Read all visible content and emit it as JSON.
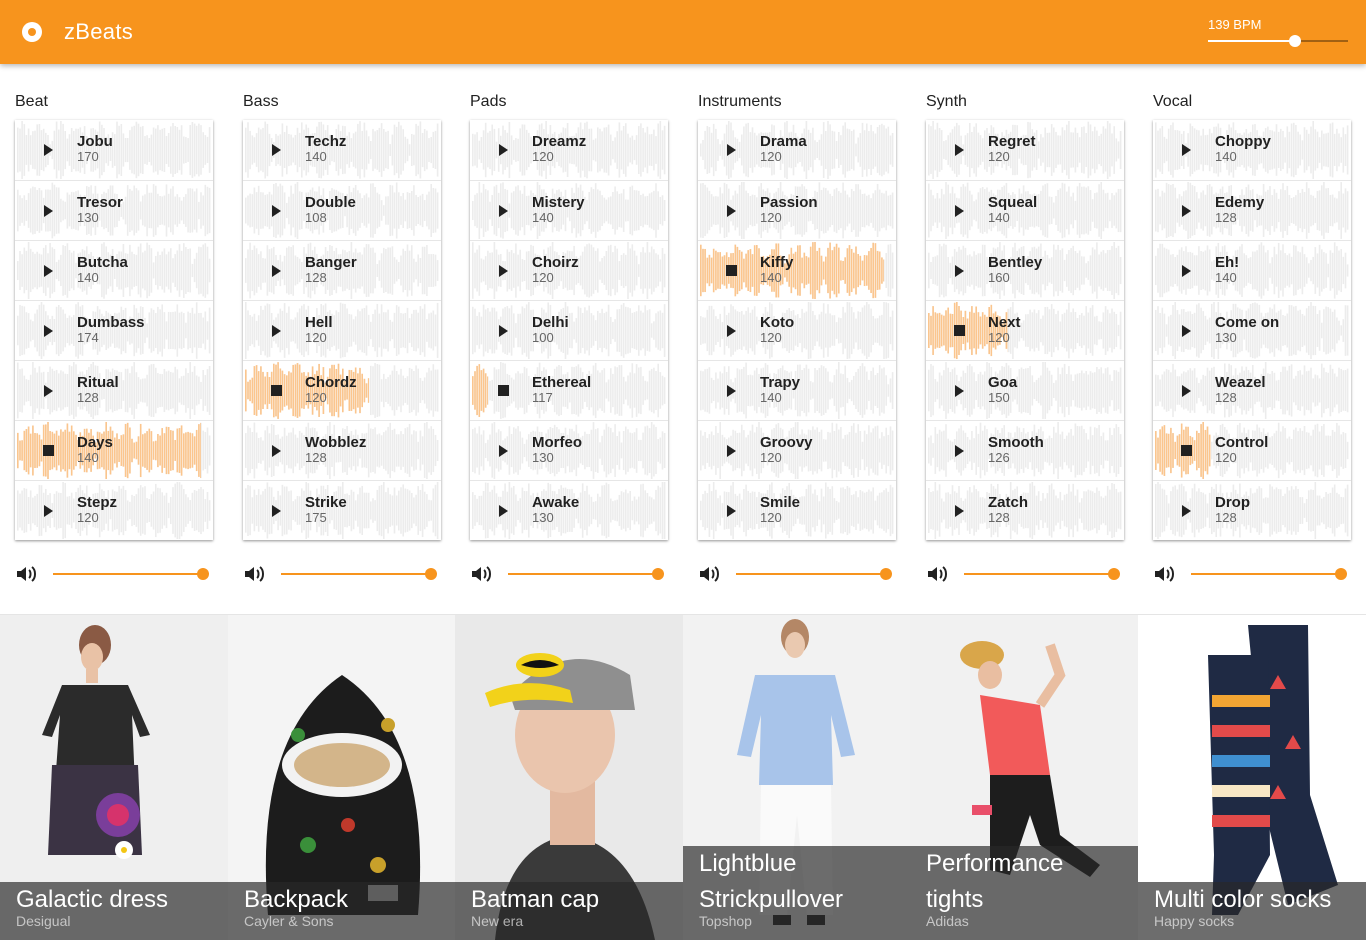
{
  "app": {
    "title": "zBeats",
    "bpm_label": "139 BPM",
    "bpm_level": 0.62
  },
  "colors": {
    "accent": "#f7941d",
    "accent_light": "#fbc58d",
    "wave_gray": "#ececec"
  },
  "icons": {
    "logo": "record-icon",
    "play": "play-icon",
    "stop": "stop-icon",
    "volume": "volume-icon"
  },
  "channels": [
    {
      "name": "Beat",
      "volume": 1.0,
      "loops": [
        {
          "name": "Jobu",
          "bpm": "170",
          "state": "idle"
        },
        {
          "name": "Tresor",
          "bpm": "130",
          "state": "idle"
        },
        {
          "name": "Butcha",
          "bpm": "140",
          "state": "idle"
        },
        {
          "name": "Dumbass",
          "bpm": "174",
          "state": "idle"
        },
        {
          "name": "Ritual",
          "bpm": "128",
          "state": "idle"
        },
        {
          "name": "Days",
          "bpm": "140",
          "state": "playing",
          "progress": 0.95
        },
        {
          "name": "Stepz",
          "bpm": "120",
          "state": "idle"
        }
      ]
    },
    {
      "name": "Bass",
      "volume": 1.0,
      "loops": [
        {
          "name": "Techz",
          "bpm": "140",
          "state": "idle"
        },
        {
          "name": "Double",
          "bpm": "108",
          "state": "idle"
        },
        {
          "name": "Banger",
          "bpm": "128",
          "state": "idle"
        },
        {
          "name": "Hell",
          "bpm": "120",
          "state": "idle"
        },
        {
          "name": "Chordz",
          "bpm": "120",
          "state": "playing",
          "progress": 0.64
        },
        {
          "name": "Wobblez",
          "bpm": "128",
          "state": "idle"
        },
        {
          "name": "Strike",
          "bpm": "175",
          "state": "idle"
        }
      ]
    },
    {
      "name": "Pads",
      "volume": 1.0,
      "loops": [
        {
          "name": "Dreamz",
          "bpm": "120",
          "state": "idle"
        },
        {
          "name": "Mistery",
          "bpm": "140",
          "state": "idle"
        },
        {
          "name": "Choirz",
          "bpm": "120",
          "state": "idle"
        },
        {
          "name": "Delhi",
          "bpm": "100",
          "state": "idle"
        },
        {
          "name": "Ethereal",
          "bpm": "117",
          "state": "playing",
          "progress": 0.08
        },
        {
          "name": "Morfeo",
          "bpm": "130",
          "state": "idle"
        },
        {
          "name": "Awake",
          "bpm": "130",
          "state": "idle"
        }
      ]
    },
    {
      "name": "Instruments",
      "volume": 1.0,
      "loops": [
        {
          "name": "Drama",
          "bpm": "120",
          "state": "idle"
        },
        {
          "name": "Passion",
          "bpm": "120",
          "state": "idle"
        },
        {
          "name": "Kiffy",
          "bpm": "140",
          "state": "playing",
          "progress": 0.95
        },
        {
          "name": "Koto",
          "bpm": "120",
          "state": "idle"
        },
        {
          "name": "Trapy",
          "bpm": "140",
          "state": "idle"
        },
        {
          "name": "Groovy",
          "bpm": "120",
          "state": "idle"
        },
        {
          "name": "Smile",
          "bpm": "120",
          "state": "idle"
        }
      ]
    },
    {
      "name": "Synth",
      "volume": 1.0,
      "loops": [
        {
          "name": "Regret",
          "bpm": "120",
          "state": "idle"
        },
        {
          "name": "Squeal",
          "bpm": "140",
          "state": "idle"
        },
        {
          "name": "Bentley",
          "bpm": "160",
          "state": "idle"
        },
        {
          "name": "Next",
          "bpm": "120",
          "state": "playing",
          "progress": 0.41
        },
        {
          "name": "Goa",
          "bpm": "150",
          "state": "idle"
        },
        {
          "name": "Smooth",
          "bpm": "126",
          "state": "idle"
        },
        {
          "name": "Zatch",
          "bpm": "128",
          "state": "idle"
        }
      ]
    },
    {
      "name": "Vocal",
      "volume": 1.0,
      "loops": [
        {
          "name": "Choppy",
          "bpm": "140",
          "state": "idle"
        },
        {
          "name": "Edemy",
          "bpm": "128",
          "state": "idle"
        },
        {
          "name": "Eh!",
          "bpm": "140",
          "state": "idle"
        },
        {
          "name": "Come on",
          "bpm": "130",
          "state": "idle"
        },
        {
          "name": "Weazel",
          "bpm": "128",
          "state": "idle"
        },
        {
          "name": "Control",
          "bpm": "120",
          "state": "playing",
          "progress": 0.29
        },
        {
          "name": "Drop",
          "bpm": "128",
          "state": "idle"
        }
      ]
    }
  ],
  "products": [
    {
      "title": "Galactic dress",
      "brand": "Desigual",
      "art": "dress"
    },
    {
      "title": "Backpack",
      "brand": "Cayler & Sons",
      "art": "backpack"
    },
    {
      "title": "Batman cap",
      "brand": "New era",
      "art": "cap"
    },
    {
      "title": "Lightblue Strickpullover",
      "brand": "Topshop",
      "art": "pullover"
    },
    {
      "title": "Performance tights",
      "brand": "Adidas",
      "art": "tights"
    },
    {
      "title": "Multi color socks",
      "brand": "Happy socks",
      "art": "socks"
    }
  ]
}
